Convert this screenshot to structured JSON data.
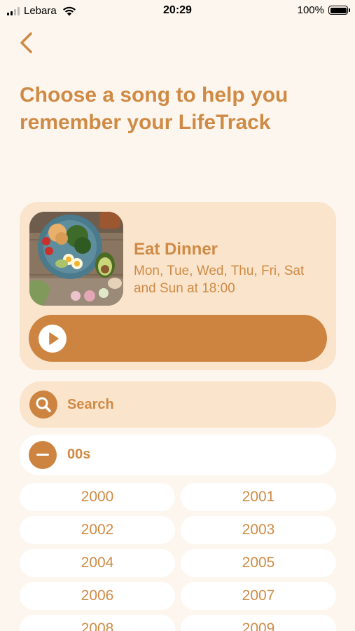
{
  "status_bar": {
    "carrier": "Lebara",
    "time": "20:29",
    "battery": "100%"
  },
  "header": {
    "title": "Choose a song to help you remember your LifeTrack"
  },
  "track_card": {
    "name": "Eat Dinner",
    "schedule": "Mon, Tue, Wed, Thu, Fri, Sat and Sun at 18:00",
    "image_icon": "food-photo"
  },
  "search": {
    "label": "Search"
  },
  "decade": {
    "label": "00s"
  },
  "years": [
    "2000",
    "2001",
    "2002",
    "2003",
    "2004",
    "2005",
    "2006",
    "2007",
    "2008",
    "2009"
  ],
  "colors": {
    "accent": "#cc8440",
    "card": "#fae4cc",
    "background": "#fdf6ee"
  }
}
